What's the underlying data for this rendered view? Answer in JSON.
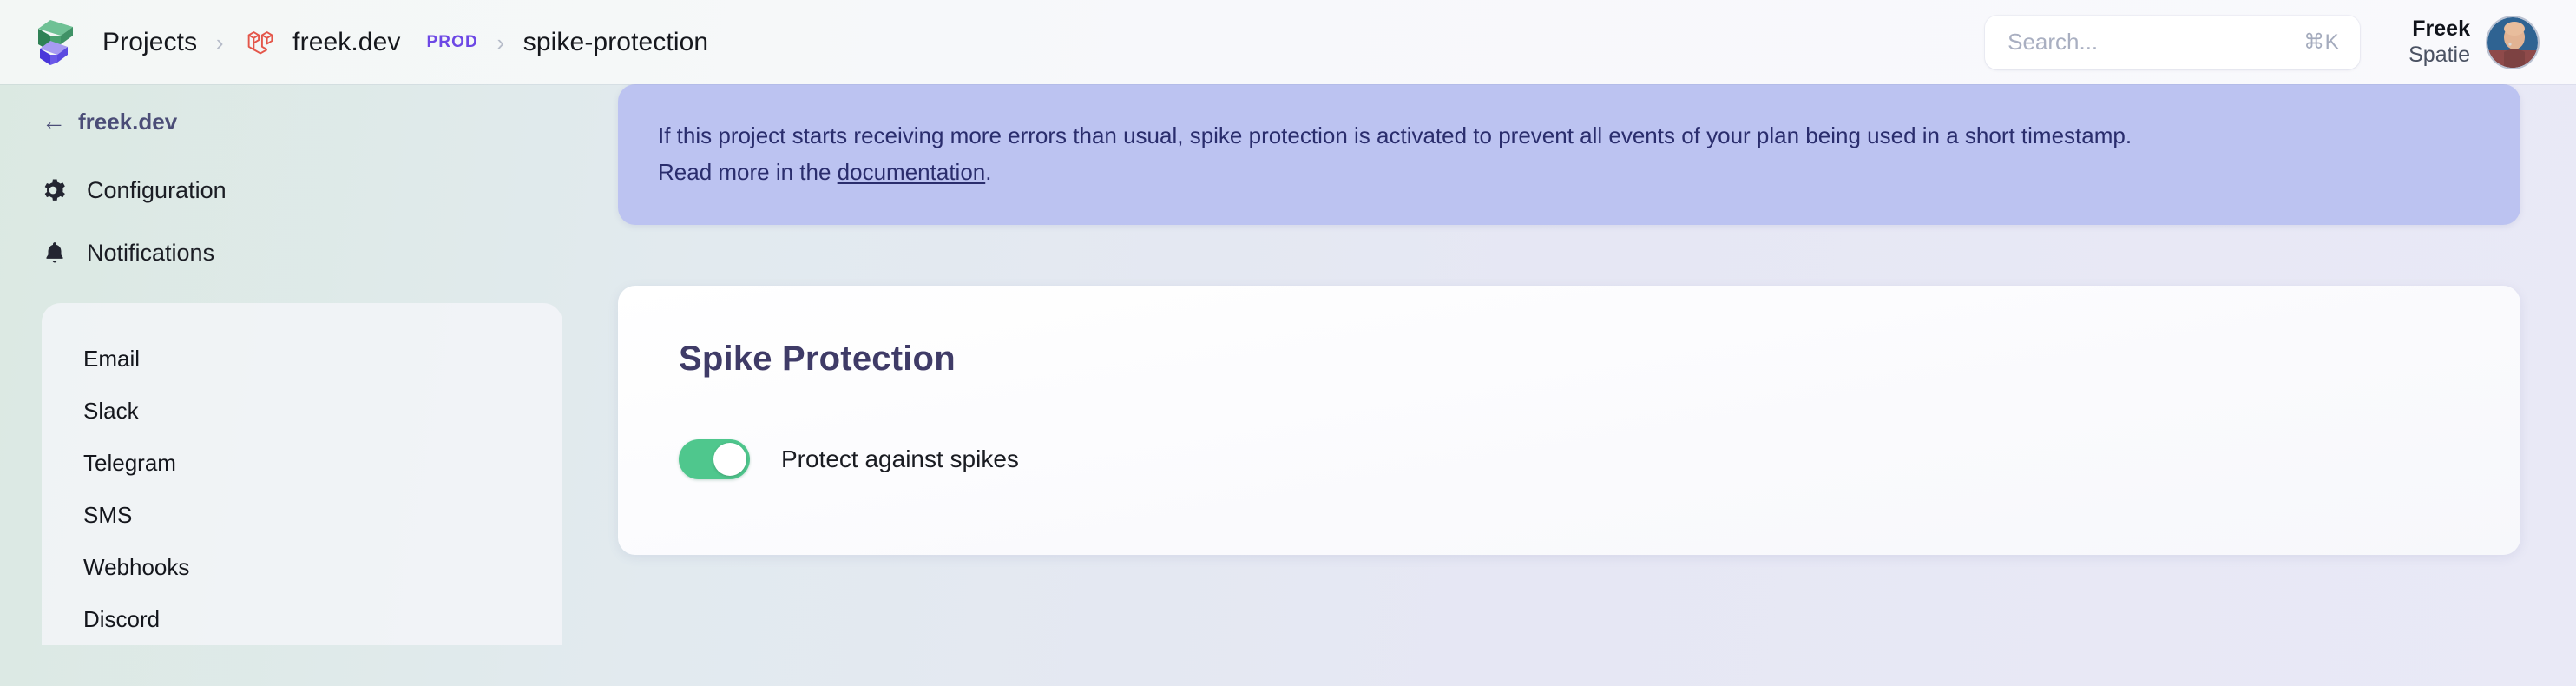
{
  "header": {
    "logo_icon": "flare-logo-icon",
    "breadcrumb": {
      "projects_label": "Projects",
      "separator": "›",
      "project_icon": "laravel-icon",
      "project_label": "freek.dev",
      "environment_badge": "PROD",
      "current_label": "spike-protection"
    },
    "search": {
      "placeholder": "Search...",
      "shortcut": "⌘K",
      "value": ""
    },
    "user": {
      "first_name": "Freek",
      "organization": "Spatie",
      "avatar_icon": "user-avatar"
    }
  },
  "sidebar": {
    "back": {
      "arrow": "←",
      "label": "freek.dev"
    },
    "nav": [
      {
        "label": "Configuration",
        "icon": "gear-icon"
      },
      {
        "label": "Notifications",
        "icon": "bell-icon"
      }
    ],
    "notification_channels": [
      {
        "label": "Email"
      },
      {
        "label": "Slack"
      },
      {
        "label": "Telegram"
      },
      {
        "label": "SMS"
      },
      {
        "label": "Webhooks"
      },
      {
        "label": "Discord"
      }
    ]
  },
  "main": {
    "banner": {
      "line1": "If this project starts receiving more errors than usual, spike protection is activated to prevent all events of your plan being used in a short timestamp.",
      "line2_prefix": "Read more in the ",
      "link_text": "documentation",
      "line2_suffix": "."
    },
    "card": {
      "title": "Spike Protection",
      "toggle_label": "Protect against spikes",
      "toggle_state": "on"
    }
  },
  "colors": {
    "banner_bg": "#bcc3f1",
    "banner_text": "#2a2d6d",
    "toggle_on": "#4fc78d",
    "prod_badge": "#6d48e5",
    "card_title": "#3f3b67",
    "laravel_red": "#e4564a",
    "logo_green": "#55ae7f",
    "logo_purple": "#6a5af0"
  }
}
